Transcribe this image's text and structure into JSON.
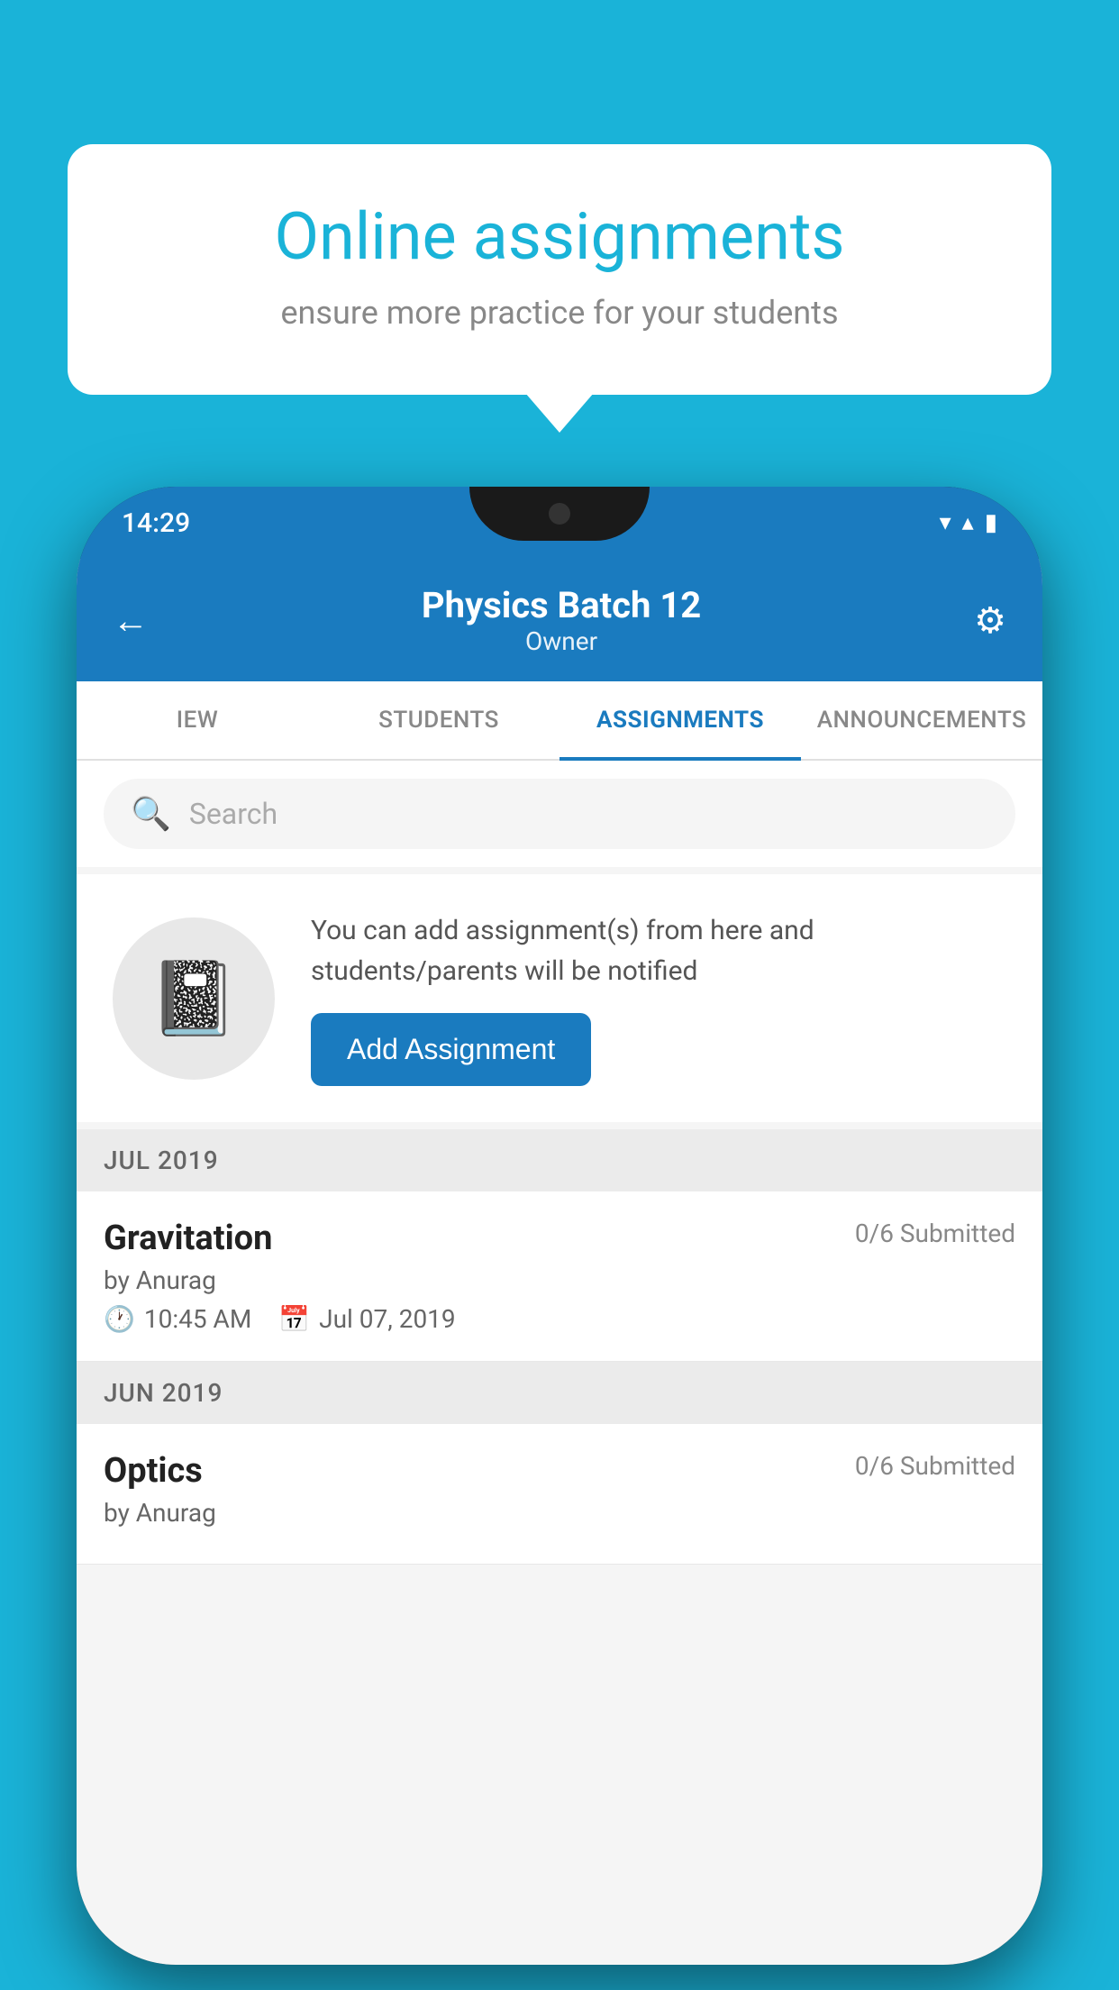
{
  "background_color": "#1ab3d8",
  "speech_bubble": {
    "title": "Online assignments",
    "subtitle": "ensure more practice for your students"
  },
  "phone": {
    "status_bar": {
      "time": "14:29",
      "wifi_icon": "▼",
      "signal_icon": "▲",
      "battery_icon": "▮"
    },
    "header": {
      "title": "Physics Batch 12",
      "subtitle": "Owner",
      "back_label": "←",
      "settings_label": "⚙"
    },
    "tabs": [
      {
        "label": "IEW",
        "active": false
      },
      {
        "label": "STUDENTS",
        "active": false
      },
      {
        "label": "ASSIGNMENTS",
        "active": true
      },
      {
        "label": "ANNOUNCEMENTS",
        "active": false
      }
    ],
    "search": {
      "placeholder": "Search"
    },
    "promo": {
      "description": "You can add assignment(s) from here and students/parents will be notified",
      "button_label": "Add Assignment"
    },
    "sections": [
      {
        "month_label": "JUL 2019",
        "assignments": [
          {
            "name": "Gravitation",
            "submitted": "0/6 Submitted",
            "by": "by Anurag",
            "time": "10:45 AM",
            "date": "Jul 07, 2019"
          }
        ]
      },
      {
        "month_label": "JUN 2019",
        "assignments": [
          {
            "name": "Optics",
            "submitted": "0/6 Submitted",
            "by": "by Anurag",
            "time": "",
            "date": ""
          }
        ]
      }
    ]
  }
}
